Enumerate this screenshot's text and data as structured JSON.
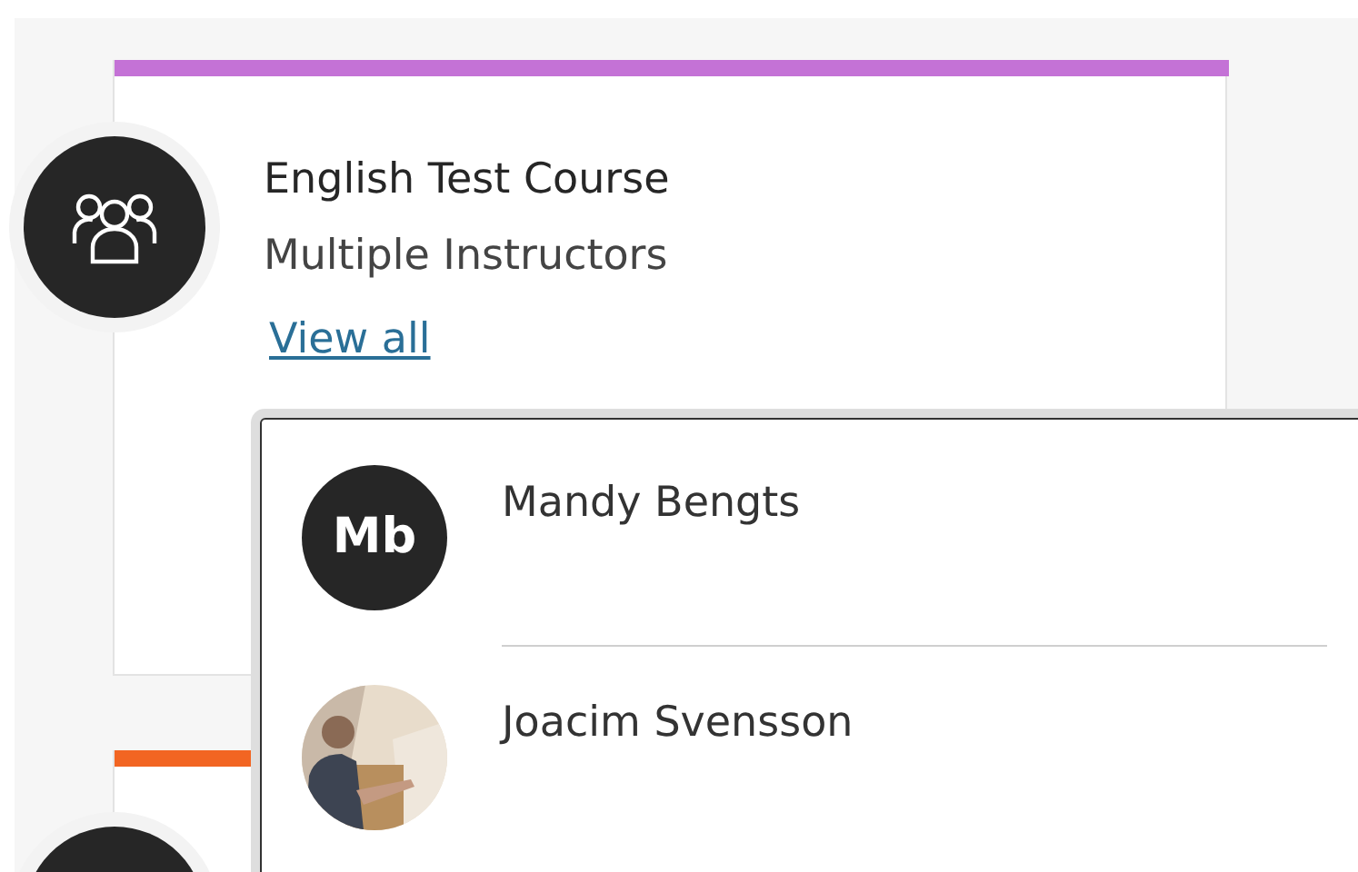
{
  "courses": [
    {
      "title": "English Test Course",
      "subtitle": "Multiple Instructors",
      "link": "View all",
      "color": "#c472d6"
    },
    {
      "color": "#f26522"
    }
  ],
  "popup": {
    "people": [
      {
        "name": "Mandy Bengts",
        "avatar": {
          "kind": "initials",
          "text": "Mb"
        }
      },
      {
        "name": "Joacim Svensson"
      }
    ]
  }
}
